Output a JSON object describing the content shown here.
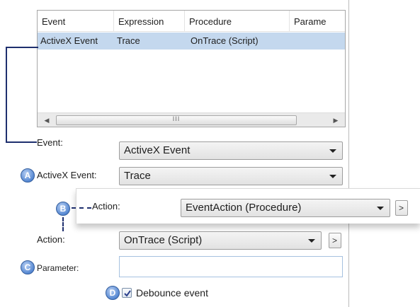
{
  "list": {
    "columns": [
      "Event",
      "Expression",
      "Procedure",
      "Parame"
    ],
    "rows": [
      {
        "event": "ActiveX Event",
        "expression": "Trace",
        "procedure": "OnTrace (Script)",
        "parameter": ""
      }
    ],
    "scroll_grip": "III"
  },
  "form": {
    "event_label": "Event:",
    "event_value": "ActiveX Event",
    "activex_event_label": "ActiveX Event:",
    "activex_event_value": "Trace",
    "action_label": "Action:",
    "action_value": "OnTrace (Script)",
    "parameter_label": "Parameter:",
    "parameter_value": "",
    "debounce_label": "Debounce event",
    "debounce_checked": true
  },
  "popup": {
    "action_label": "Action:",
    "action_value": "EventAction (Procedure)"
  },
  "callouts": {
    "a": "A",
    "b": "B",
    "c": "C",
    "d": "D"
  },
  "buttons": {
    "more": ">"
  },
  "colors": {
    "selection": "#c4d8ee",
    "connector": "#1e2f6e",
    "callout": "#4f83d0"
  }
}
